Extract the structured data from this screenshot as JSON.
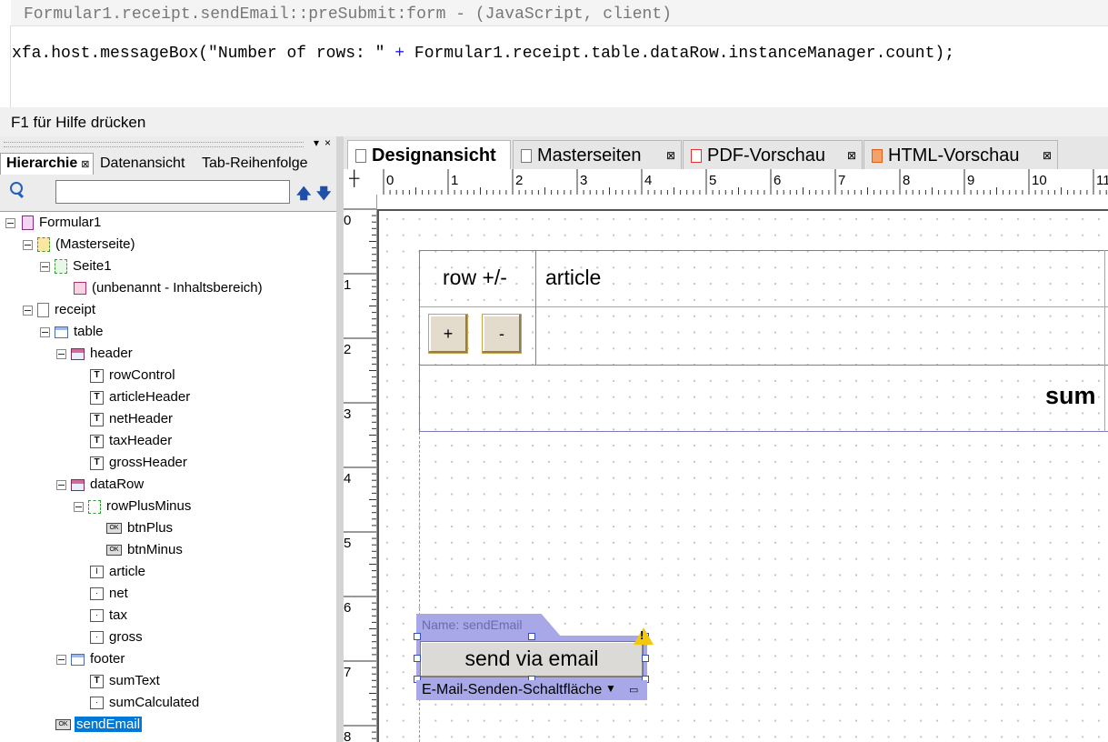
{
  "script": {
    "header": "Formular1.receipt.sendEmail::preSubmit:form - (JavaScript, client)",
    "code_before": "xfa.host.messageBox(\"Number of rows: \" ",
    "code_operator": "+",
    "code_after": " Formular1.receipt.table.dataRow.instanceManager.count);"
  },
  "status": {
    "text": "F1 für Hilfe drücken"
  },
  "panel": {
    "tabs": [
      "Hierarchie",
      "Datenansicht",
      "Tab-Reihenfolge"
    ],
    "controls": {
      "pin": "▾",
      "close": "×"
    },
    "search": {
      "value": "",
      "placeholder": "",
      "up_icon": "arrow-up-icon",
      "down_icon": "arrow-down-icon"
    },
    "tree": [
      {
        "label": "Formular1",
        "icon": "form-icon"
      },
      {
        "label": "(Masterseite)",
        "icon": "masterpage-icon"
      },
      {
        "label": "Seite1",
        "icon": "pagearea-icon"
      },
      {
        "label": "(unbenannt - Inhaltsbereich)",
        "icon": "contentarea-icon"
      },
      {
        "label": "receipt",
        "icon": "subform-icon"
      },
      {
        "label": "table",
        "icon": "table-icon"
      },
      {
        "label": "header",
        "icon": "row-icon"
      },
      {
        "label": "rowControl",
        "icon": "text-icon"
      },
      {
        "label": "articleHeader",
        "icon": "text-icon"
      },
      {
        "label": "netHeader",
        "icon": "text-icon"
      },
      {
        "label": "taxHeader",
        "icon": "text-icon"
      },
      {
        "label": "grossHeader",
        "icon": "text-icon"
      },
      {
        "label": "dataRow",
        "icon": "row-icon"
      },
      {
        "label": "rowPlusMinus",
        "icon": "subform-icon"
      },
      {
        "label": "btnPlus",
        "icon": "button-icon"
      },
      {
        "label": "btnMinus",
        "icon": "button-icon"
      },
      {
        "label": "article",
        "icon": "textfield-icon"
      },
      {
        "label": "net",
        "icon": "numeric-icon"
      },
      {
        "label": "tax",
        "icon": "numeric-icon"
      },
      {
        "label": "gross",
        "icon": "numeric-icon"
      },
      {
        "label": "footer",
        "icon": "row-icon"
      },
      {
        "label": "sumText",
        "icon": "text-icon"
      },
      {
        "label": "sumCalculated",
        "icon": "numeric-icon"
      },
      {
        "label": "sendEmail",
        "icon": "button-icon",
        "selected": true
      }
    ]
  },
  "doc_tabs": [
    {
      "label": "Designansicht",
      "active": true
    },
    {
      "label": "Masterseiten"
    },
    {
      "label": "PDF-Vorschau"
    },
    {
      "label": "HTML-Vorschau"
    }
  ],
  "ruler": {
    "h": [
      "0",
      "1",
      "2",
      "3",
      "4",
      "5",
      "6",
      "7",
      "8",
      "9",
      "10",
      "11"
    ],
    "v": [
      "0",
      "1",
      "2",
      "3",
      "4",
      "5",
      "6",
      "7",
      "8"
    ]
  },
  "design": {
    "row_header": "row +/-",
    "article_header": "article",
    "plus_label": "+",
    "minus_label": "-",
    "sum_label": "sum",
    "selection_name": "Name: sendEmail",
    "send_button": "send via email",
    "object_type": "E-Mail-Senden-Schaltfläche",
    "warning_icon": "warning-icon"
  },
  "colors": {
    "selection": "#0078d7",
    "object_frame": "#a8a8e8",
    "table_border": "#7a7ab8",
    "warning": "#f2c811"
  }
}
